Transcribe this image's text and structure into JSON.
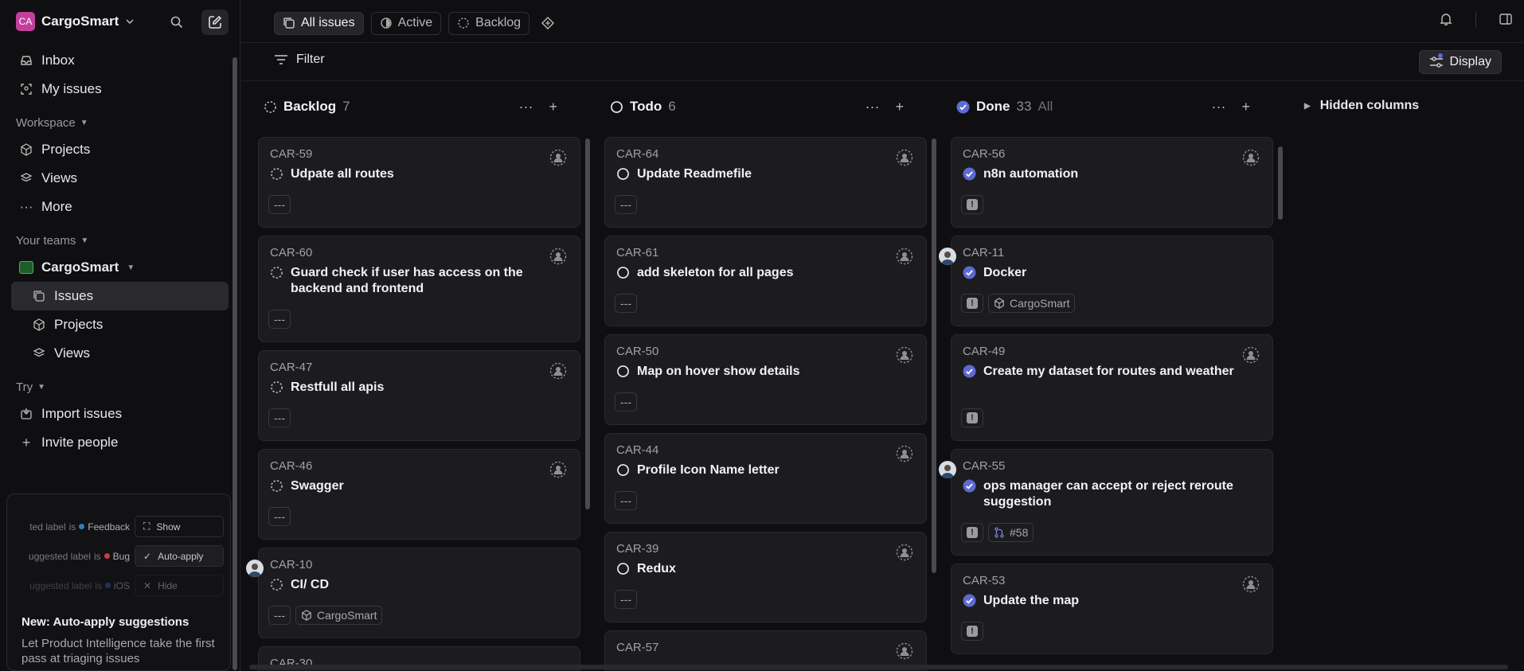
{
  "workspace": {
    "initials": "CA",
    "name": "CargoSmart",
    "color": "#c2409c"
  },
  "nav": {
    "inbox": "Inbox",
    "my_issues": "My issues"
  },
  "workspace_section": {
    "label": "Workspace",
    "projects": "Projects",
    "views": "Views",
    "more": "More"
  },
  "teams_section": {
    "label": "Your teams",
    "team_name": "CargoSmart",
    "issues": "Issues",
    "projects": "Projects",
    "views": "Views"
  },
  "try_section": {
    "label": "Try",
    "import": "Import issues",
    "invite": "Invite people"
  },
  "promo": {
    "rows": [
      {
        "label": "ted label",
        "is": "is",
        "value": "Feedback",
        "dot": "#2f97c6",
        "button": "Show"
      },
      {
        "label": "uggested label",
        "is": "is",
        "value": "Bug",
        "dot": "#e5484d",
        "button": "Auto-apply"
      },
      {
        "label": "uggested label",
        "is": "is",
        "value": "iOS",
        "dot": "#3e63dd",
        "button": "Hide"
      }
    ],
    "title": "New: Auto-apply suggestions",
    "text": "Let Product Intelligence take the first pass at triaging issues"
  },
  "tabs": {
    "all": "All issues",
    "active": "Active",
    "backlog": "Backlog"
  },
  "toolbar": {
    "filter": "Filter",
    "display": "Display"
  },
  "hidden_columns": "Hidden columns",
  "columns": {
    "backlog": {
      "name": "Backlog",
      "count": "7",
      "cards": [
        {
          "id": "CAR-59",
          "title": "Udpate all routes"
        },
        {
          "id": "CAR-60",
          "title": "Guard check if user has access on the backend and frontend"
        },
        {
          "id": "CAR-47",
          "title": "Restfull all apis"
        },
        {
          "id": "CAR-46",
          "title": "Swagger"
        },
        {
          "id": "CAR-10",
          "title": "CI/ CD",
          "project": "CargoSmart"
        },
        {
          "id": "CAR-30",
          "title": ""
        }
      ]
    },
    "todo": {
      "name": "Todo",
      "count": "6",
      "cards": [
        {
          "id": "CAR-64",
          "title": "Update Readmefile"
        },
        {
          "id": "CAR-61",
          "title": "add skeleton for all pages"
        },
        {
          "id": "CAR-50",
          "title": "Map on hover show details"
        },
        {
          "id": "CAR-44",
          "title": "Profile Icon Name letter"
        },
        {
          "id": "CAR-39",
          "title": "Redux"
        },
        {
          "id": "CAR-57",
          "title": ""
        }
      ]
    },
    "done": {
      "name": "Done",
      "count": "33",
      "all": "All",
      "cards": [
        {
          "id": "CAR-56",
          "title": "n8n automation"
        },
        {
          "id": "CAR-11",
          "title": "Docker",
          "project": "CargoSmart"
        },
        {
          "id": "CAR-49",
          "title": "Create my dataset for routes and weather"
        },
        {
          "id": "CAR-55",
          "title": "ops manager can accept or reject reroute suggestion",
          "pr": "#58"
        },
        {
          "id": "CAR-53",
          "title": "Update the map"
        }
      ]
    }
  },
  "empty_priority": "---",
  "colors": {
    "accent": "#5e6ad2",
    "done": "#5e6ad2"
  }
}
